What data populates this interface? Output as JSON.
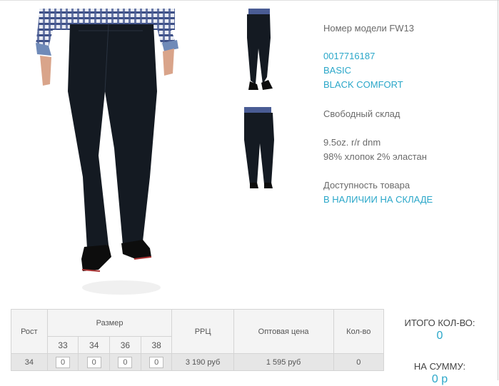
{
  "product": {
    "model_label": "Номер модели FW13",
    "article": "0017716187",
    "line": "BASIC",
    "color": "BLACK COMFORT",
    "fit": "Свободный склад",
    "fabric_weight": "9.5oz. r/r dnm",
    "composition": "98% хлопок 2% эластан",
    "availability_label": "Доступность товара",
    "availability_value": "В НАЛИЧИИ НА СКЛАДЕ"
  },
  "colors": {
    "link": "#2aa7c9",
    "pants": "#141a22",
    "shirt_blue": "#3d4f86"
  },
  "table": {
    "header_rost": "Рост",
    "header_size": "Размер",
    "sizes": [
      "33",
      "34",
      "36",
      "38"
    ],
    "header_rrc": "РРЦ",
    "header_wholesale": "Оптовая цена",
    "header_qty": "Кол-во",
    "row": {
      "rost": "34",
      "inputs": [
        "0",
        "0",
        "0",
        "0"
      ],
      "rrc": "3 190 руб",
      "wholesale": "1 595 руб",
      "qty": "0"
    }
  },
  "totals": {
    "count_label": "ИТОГО КОЛ-ВО:",
    "count_value": "0",
    "sum_label": "НА СУММУ:",
    "sum_value": "0 р"
  }
}
